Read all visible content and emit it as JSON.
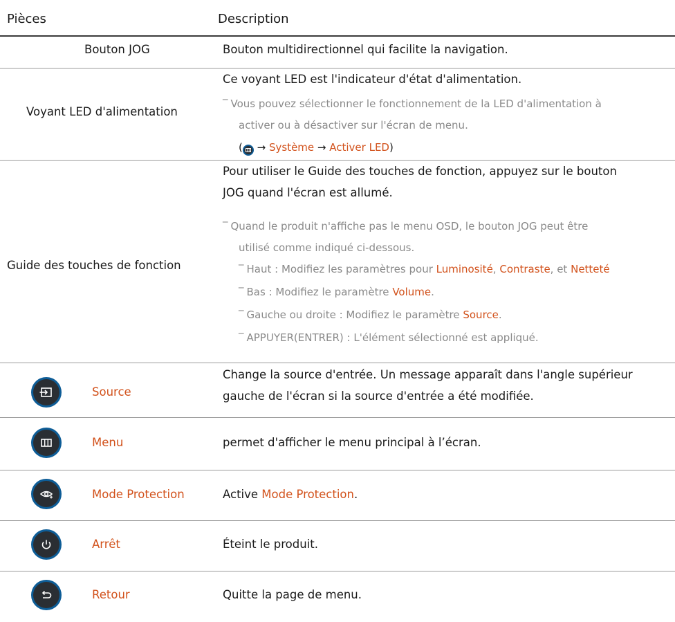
{
  "header": {
    "col_parts": "Pièces",
    "col_desc": "Description"
  },
  "rows": {
    "jog": {
      "part": "Bouton JOG",
      "desc": "Bouton multidirectionnel qui facilite la navigation."
    },
    "led": {
      "part": "Voyant LED d'alimentation",
      "desc": "Ce voyant LED est l'indicateur d'état d'alimentation.",
      "note_line1": "Vous pouvez sélectionner le fonctionnement de la LED d'alimentation à",
      "note_line2": "activer ou à désactiver sur l'écran de menu.",
      "path_open": "(",
      "path_arrow1": " → ",
      "path_system": "Système",
      "path_arrow2": " → ",
      "path_led": "Activer LED",
      "path_close": ")"
    },
    "guide": {
      "part": "Guide des touches de fonction",
      "desc_line1": "Pour utiliser le Guide des touches de fonction, appuyez sur le bouton",
      "desc_line2": "JOG quand l'écran est allumé.",
      "note_line1": "Quand le produit n'affiche pas le menu OSD, le bouton JOG peut être",
      "note_line2": "utilisé comme indiqué ci-dessous.",
      "up_text": "Haut : Modifiez les paramètres pour ",
      "up_lum": "Luminosité",
      "up_sep1": ", ",
      "up_contrast": "Contraste",
      "up_sep2": ", et ",
      "up_sharp": "Netteté",
      "down_text": "Bas : Modifiez le paramètre ",
      "down_volume": "Volume",
      "down_end": ".",
      "lr_text": "Gauche ou droite : Modifiez le paramètre ",
      "lr_source": "Source",
      "lr_end": ".",
      "press_text": "APPUYER(ENTRER) : L'élément sélectionné est appliqué."
    },
    "source": {
      "icon": "source-icon",
      "part": "Source",
      "desc_line1": "Change la source d'entrée. Un message apparaît dans l'angle supérieur",
      "desc_line2": "gauche de l'écran si la source d'entrée a été modifiée."
    },
    "menu": {
      "icon": "menu-icon",
      "part": "Menu",
      "desc": "permet d'afficher le menu principal à l’écran."
    },
    "eye": {
      "icon": "eye-saver-icon",
      "part": "Mode Protection",
      "desc_prefix": "Active ",
      "desc_link": "Mode Protection",
      "desc_end": "."
    },
    "power": {
      "icon": "power-icon",
      "part": "Arrêt",
      "desc": "Éteint le produit."
    },
    "back": {
      "icon": "back-icon",
      "part": "Retour",
      "desc": "Quitte la page de menu."
    }
  },
  "colors": {
    "accent": "#d2521c",
    "icon_ring": "#0e5d97",
    "icon_fill": "#2a2e33",
    "note": "#8a8a8a"
  }
}
